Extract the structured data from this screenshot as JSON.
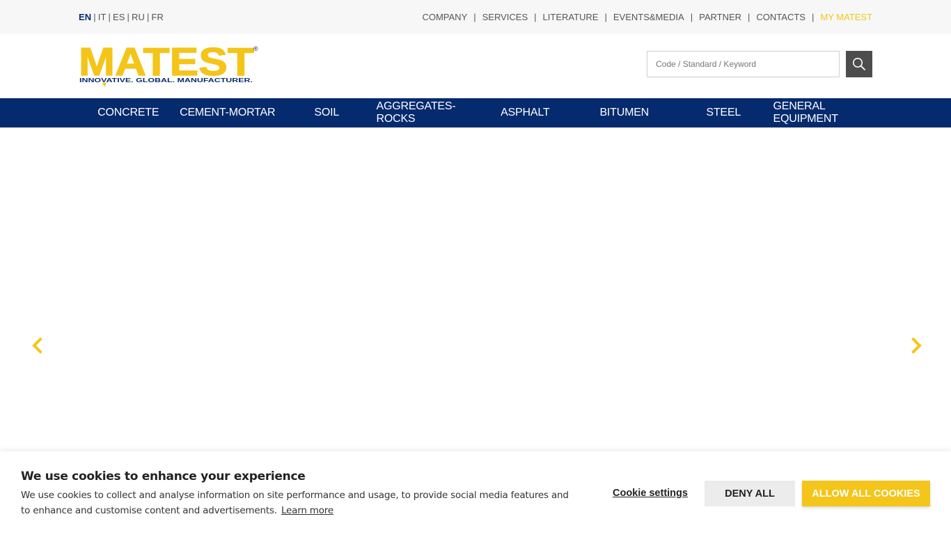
{
  "languages": [
    {
      "label": "EN",
      "active": true
    },
    {
      "label": "IT",
      "active": false
    },
    {
      "label": "ES",
      "active": false
    },
    {
      "label": "RU",
      "active": false
    },
    {
      "label": "FR",
      "active": false
    }
  ],
  "top_links": [
    {
      "label": "COMPANY"
    },
    {
      "label": "SERVICES"
    },
    {
      "label": "LITERATURE"
    },
    {
      "label": "EVENTS&MEDIA"
    },
    {
      "label": "PARTNER"
    },
    {
      "label": "CONTACTS"
    },
    {
      "label": "MY MATEST"
    }
  ],
  "separator": "|",
  "logo": {
    "wordmark": "MATEST",
    "tagline": "INNOVATIVE. GLOBAL. MANUFACTURER.",
    "registered": "®"
  },
  "search": {
    "placeholder": "Code / Standard / Keyword",
    "value": "",
    "icon": "search-icon"
  },
  "main_nav": [
    {
      "label": "CONCRETE"
    },
    {
      "label": "CEMENT-MORTAR"
    },
    {
      "label": "SOIL"
    },
    {
      "label": "AGGREGATES-ROCKS"
    },
    {
      "label": "ASPHALT"
    },
    {
      "label": "BITUMEN"
    },
    {
      "label": "STEEL"
    },
    {
      "label": "GENERAL EQUIPMENT"
    }
  ],
  "slider": {
    "prev_icon": "chevron-left-icon",
    "next_icon": "chevron-right-icon"
  },
  "cookie": {
    "title": "We use cookies to enhance your experience",
    "text": "We use cookies to collect and analyse information on site performance and usage, to provide social media features and to enhance and customise content and advertisements.",
    "learn_more": "Learn more",
    "settings_label": "Cookie settings",
    "deny_label": "DENY ALL",
    "allow_label": "ALLOW ALL COOKIES"
  },
  "colors": {
    "brand_yellow": "#f4c518",
    "brand_navy": "#062a6e",
    "topbar_bg": "#f7f7f7",
    "search_button": "#4d4d4d"
  }
}
